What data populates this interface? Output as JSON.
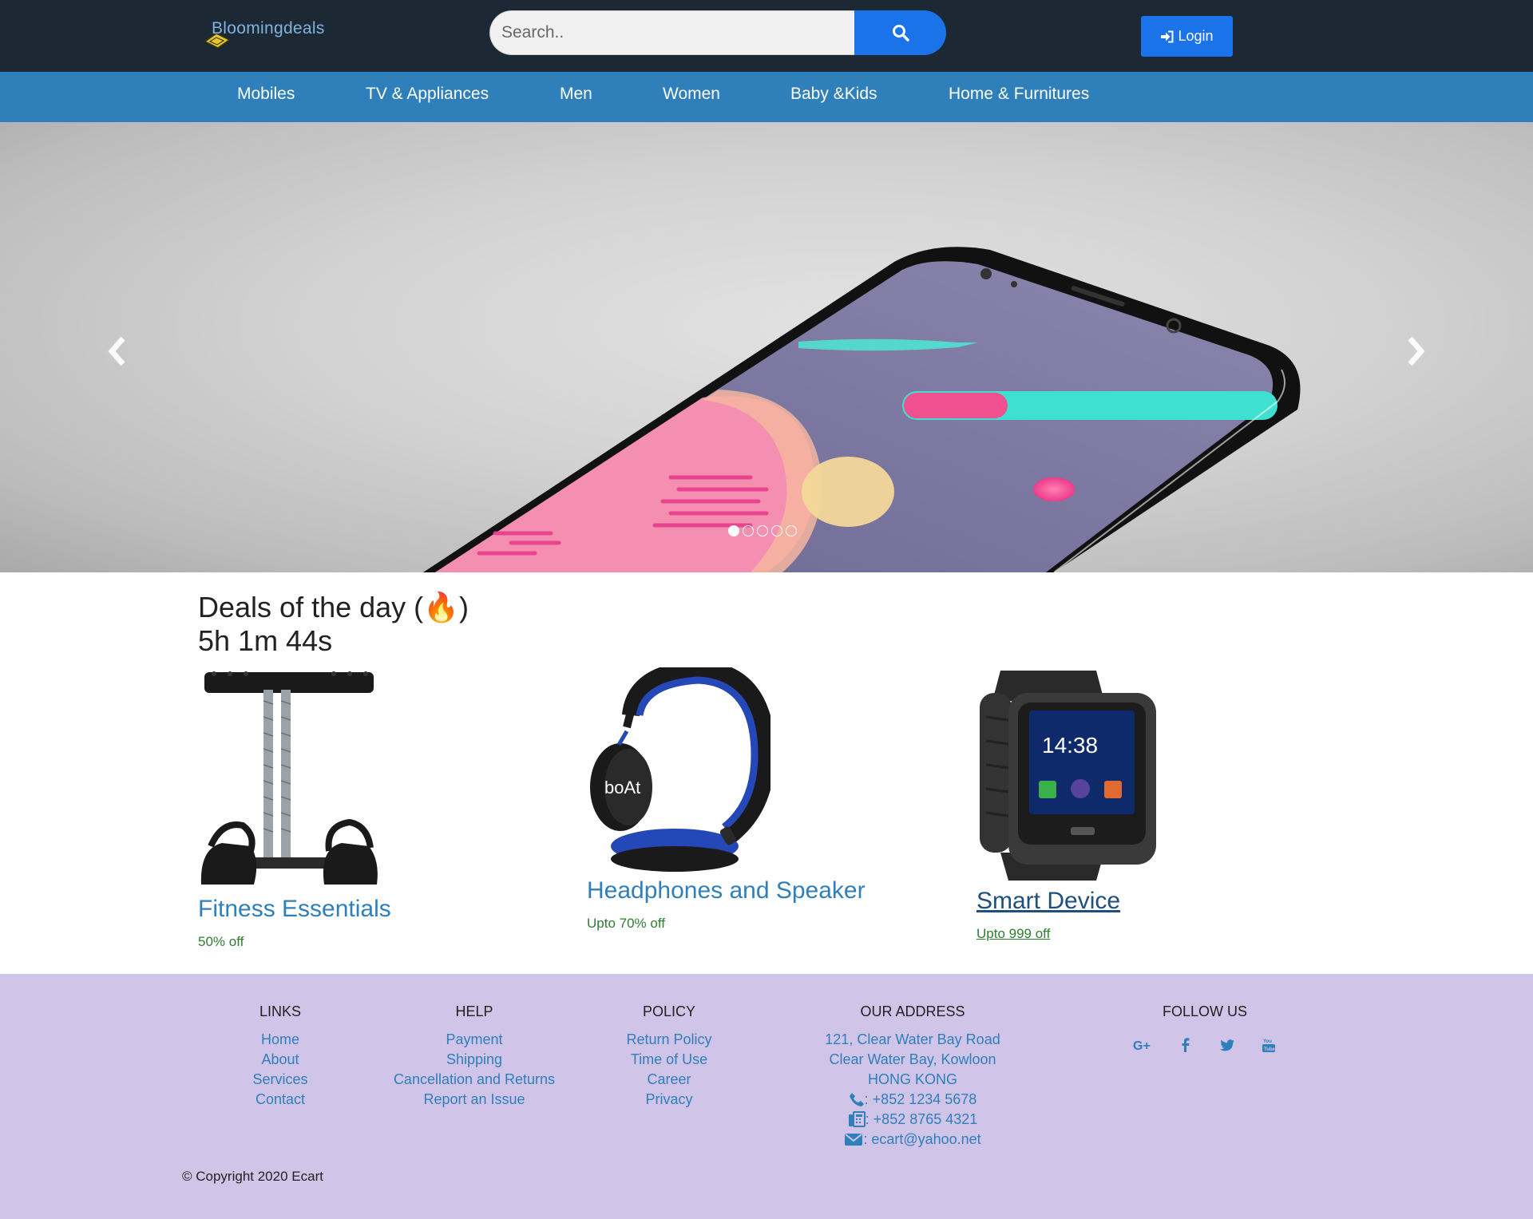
{
  "brand": {
    "name": "Bloomingdeals"
  },
  "search": {
    "placeholder": "Search.."
  },
  "header": {
    "login_label": "Login"
  },
  "nav": {
    "items": [
      "Mobiles",
      "TV & Appliances",
      "Men",
      "Women",
      "Baby &Kids",
      "Home & Furnitures"
    ]
  },
  "carousel": {
    "slide_count": 5,
    "active_slide": 1
  },
  "deals": {
    "title": "Deals of the day (🔥)",
    "timer": "5h 1m 44s",
    "items": [
      {
        "name": "Fitness Essentials",
        "offer": "50% off"
      },
      {
        "name": "Headphones and Speaker",
        "offer": "Upto 70% off"
      },
      {
        "name": "Smart Device",
        "offer": "Upto 999 off"
      }
    ]
  },
  "footer": {
    "links": {
      "heading": "LINKS",
      "items": [
        "Home",
        "About",
        "Services",
        "Contact"
      ]
    },
    "help": {
      "heading": "HELP",
      "items": [
        "Payment",
        "Shipping",
        "Cancellation and Returns",
        "Report an Issue"
      ]
    },
    "policy": {
      "heading": "POLICY",
      "items": [
        "Return Policy",
        "Time of Use",
        "Career",
        "Privacy"
      ]
    },
    "address": {
      "heading": "OUR ADDRESS",
      "lines": [
        "121, Clear Water Bay Road",
        "Clear Water Bay, Kowloon",
        "HONG KONG"
      ],
      "phone": ": +852 1234 5678",
      "fax": ": +852 8765 4321",
      "email": ": ecart@yahoo.net"
    },
    "follow": {
      "heading": "FOLLOW US",
      "icons": [
        "google-plus-icon",
        "facebook-icon",
        "twitter-icon",
        "youtube-icon"
      ]
    },
    "copyright": "© Copyright 2020 Ecart"
  },
  "colors": {
    "topbar": "#1c2833",
    "nav": "#2f7fbb",
    "accent": "#1a73e8",
    "footer": "#d0c4e8",
    "link": "#2f7fbb",
    "offer": "#2e7d32"
  }
}
